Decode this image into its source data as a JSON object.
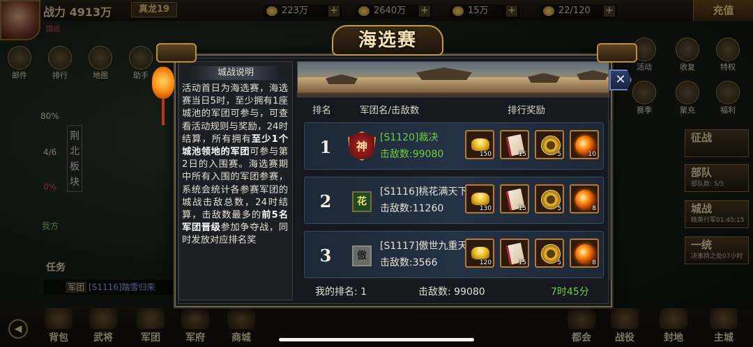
{
  "topbar": {
    "power_label": "战力",
    "power_value": "4913万",
    "rank_badge": "真龙19",
    "guild": "国运",
    "resources": [
      {
        "icon": "grain-icon",
        "value": "223万",
        "plus": "+"
      },
      {
        "icon": "copper-coin-icon",
        "value": "2640万",
        "plus": "+"
      },
      {
        "icon": "gold-ingot-icon",
        "value": "15万",
        "plus": "+"
      },
      {
        "icon": "energy-icon",
        "value": "22/120",
        "plus": "+"
      }
    ],
    "recharge": "充值"
  },
  "left_icons": [
    {
      "label": "邮件"
    },
    {
      "label": "排行"
    },
    {
      "label": "地图"
    },
    {
      "label": "助手"
    }
  ],
  "left_side": {
    "stat1": "80%",
    "stat2": "4/6",
    "stat3": "0%",
    "me": "我方",
    "region": "荆北板块",
    "task": "任务"
  },
  "right_icons": [
    {
      "label": "活动"
    },
    {
      "label": "收复"
    },
    {
      "label": "特权"
    },
    {
      "label": "赛季"
    },
    {
      "label": "聚充"
    },
    {
      "label": "福利"
    }
  ],
  "right_buttons": [
    {
      "label": "征战",
      "sub": ""
    },
    {
      "label": "部队",
      "sub": "部队数: 5/5"
    },
    {
      "label": "城战",
      "sub": "精英行军01:45:15"
    },
    {
      "label": "一统",
      "sub": "决事持之处07小时"
    }
  ],
  "chat": {
    "channel": "军团",
    "text": "[S1116]踏雪归来"
  },
  "bottom_nav": [
    {
      "label": "背包"
    },
    {
      "label": "武将"
    },
    {
      "label": "军团"
    },
    {
      "label": "军府"
    },
    {
      "label": "商城"
    },
    {
      "label": "都会"
    },
    {
      "label": "战役"
    },
    {
      "label": "封地"
    },
    {
      "label": "主城"
    }
  ],
  "dialog": {
    "title": "海选赛",
    "close": "✕",
    "info_title": "城战说明",
    "info_parts": [
      "活动首日为海选赛，海选赛当日5时，至少拥有1座城池的军团可参与，可查看活动规则与奖励，24时结算，所有拥有",
      "至少1个城池领地的军团",
      "可参与第2日的入围赛。海选赛期中所有入围的军团参赛，系统会统计各参赛军团的城战击敌总数，24时结算，击敌数最多的",
      "前5名军团晋级",
      "参加争夺战，同时发放对应排名奖"
    ],
    "headers": {
      "rank": "排名",
      "guild": "军团名/击敌数",
      "reward": "排行奖励"
    },
    "rows": [
      {
        "rank": "1",
        "emblem": "神",
        "name": "[S1120]裁决",
        "kills": "击敌数:99080",
        "rewards": [
          {
            "type": "ingot",
            "count": "150"
          },
          {
            "type": "book",
            "count": "15"
          },
          {
            "type": "coin",
            "count": "5"
          },
          {
            "type": "orb",
            "count": "10"
          }
        ]
      },
      {
        "rank": "2",
        "emblem": "花",
        "name": "[S1116]桃花满天下",
        "kills": "击敌数:11260",
        "rewards": [
          {
            "type": "ingot",
            "count": "130"
          },
          {
            "type": "book",
            "count": "15"
          },
          {
            "type": "coin",
            "count": "5"
          },
          {
            "type": "orb",
            "count": "8"
          }
        ]
      },
      {
        "rank": "3",
        "emblem": "傲",
        "name": "[S1117]傲世九重天",
        "kills": "击敌数:3566",
        "rewards": [
          {
            "type": "ingot",
            "count": "120"
          },
          {
            "type": "book",
            "count": "15"
          },
          {
            "type": "coin",
            "count": "5"
          },
          {
            "type": "orb",
            "count": "8"
          }
        ]
      }
    ],
    "footer": {
      "my_rank": "我的排名: 1",
      "kills": "击敌数:  99080",
      "time": "7时45分"
    }
  }
}
